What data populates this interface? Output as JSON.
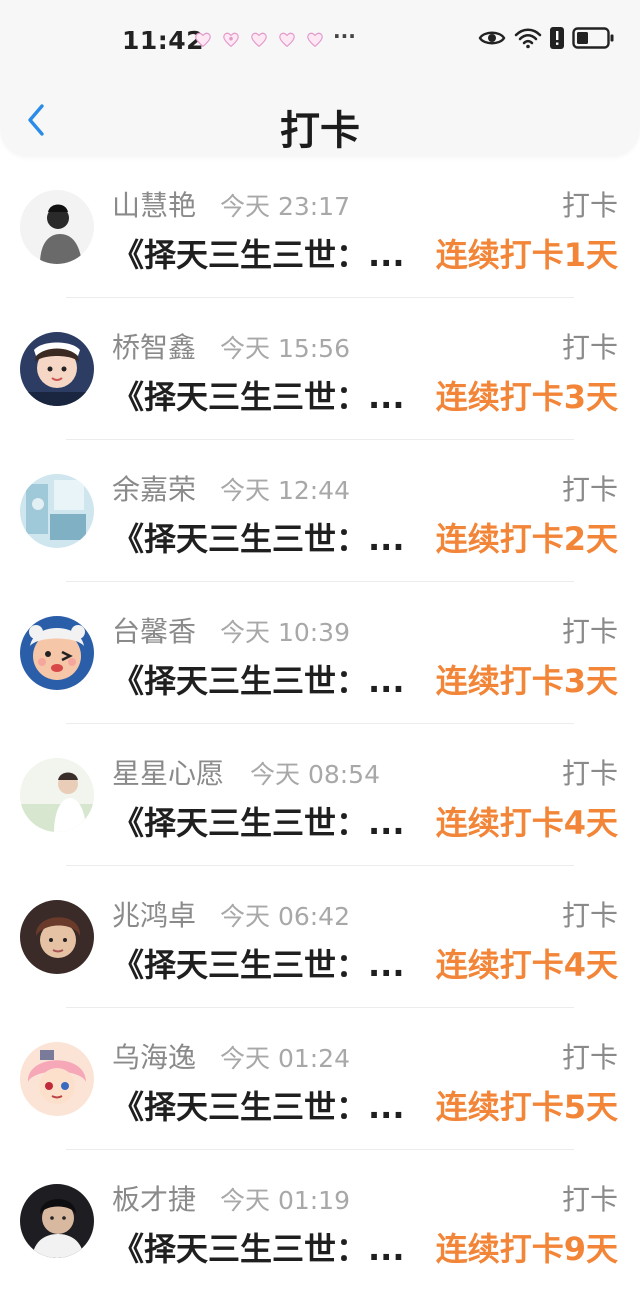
{
  "status_bar": {
    "time": "11:42",
    "more": "···"
  },
  "header": {
    "title": "打卡"
  },
  "entries": [
    {
      "name": "山慧艳",
      "time": "今天 23:17",
      "action": "打卡",
      "book": "《择天三生三世：...",
      "streak": "连续打卡1天"
    },
    {
      "name": "桥智鑫",
      "time": "今天 15:56",
      "action": "打卡",
      "book": "《择天三生三世：...",
      "streak": "连续打卡3天"
    },
    {
      "name": "余嘉荣",
      "time": "今天 12:44",
      "action": "打卡",
      "book": "《择天三生三世：...",
      "streak": "连续打卡2天"
    },
    {
      "name": "台馨香",
      "time": "今天 10:39",
      "action": "打卡",
      "book": "《择天三生三世：...",
      "streak": "连续打卡3天"
    },
    {
      "name": "星星心愿",
      "time": "今天 08:54",
      "action": "打卡",
      "book": "《择天三生三世：...",
      "streak": "连续打卡4天"
    },
    {
      "name": "兆鸿卓",
      "time": "今天 06:42",
      "action": "打卡",
      "book": "《择天三生三世：...",
      "streak": "连续打卡4天"
    },
    {
      "name": "乌海逸",
      "time": "今天 01:24",
      "action": "打卡",
      "book": "《择天三生三世：...",
      "streak": "连续打卡5天"
    },
    {
      "name": "板才捷",
      "time": "今天 01:19",
      "action": "打卡",
      "book": "《择天三生三世：...",
      "streak": "连续打卡9天"
    }
  ],
  "colors": {
    "accent": "#f28537",
    "back": "#2b8ce8"
  }
}
